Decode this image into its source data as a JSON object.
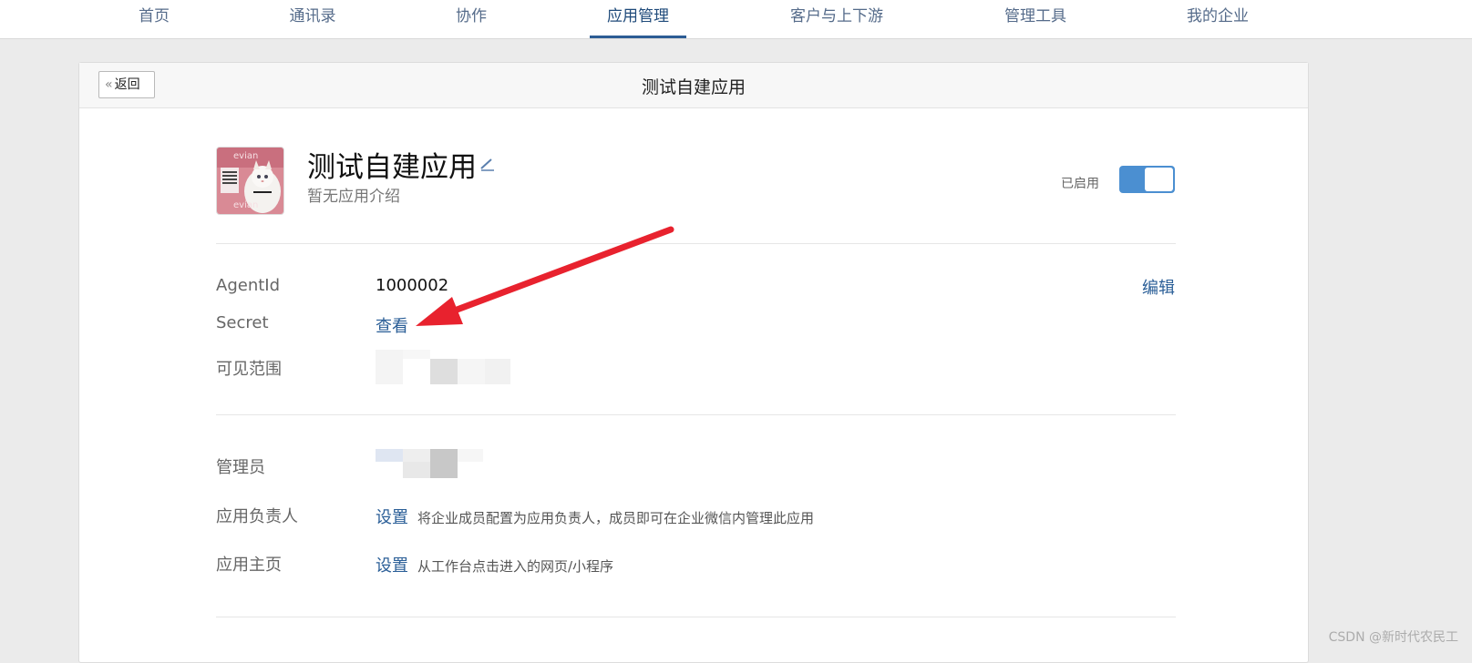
{
  "nav": {
    "items": [
      {
        "label": "首页",
        "active": false
      },
      {
        "label": "通讯录",
        "active": false
      },
      {
        "label": "协作",
        "active": false
      },
      {
        "label": "应用管理",
        "active": true
      },
      {
        "label": "客户与上下游",
        "active": false
      },
      {
        "label": "管理工具",
        "active": false
      },
      {
        "label": "我的企业",
        "active": false
      }
    ]
  },
  "header": {
    "back_label": "返回",
    "title": "测试自建应用"
  },
  "app": {
    "name": "测试自建应用",
    "description": "暂无应用介绍",
    "status_label": "已启用",
    "enabled": true,
    "logo_text_top": "evian",
    "logo_text_bottom": "evian"
  },
  "details": {
    "agentid_label": "AgentId",
    "agentid_value": "1000002",
    "edit_label": "编辑",
    "secret_label": "Secret",
    "secret_action": "查看",
    "visible_range_label": "可见范围"
  },
  "admin": {
    "admin_label": "管理员",
    "owner_label": "应用负责人",
    "owner_action": "设置",
    "owner_hint": "将企业成员配置为应用负责人，成员即可在企业微信内管理此应用",
    "home_label": "应用主页",
    "home_action": "设置",
    "home_hint": "从工作台点击进入的网页/小程序"
  },
  "watermark": "CSDN @新时代农民工",
  "colors": {
    "accent": "#2a5e97",
    "toggle": "#4b8fd1",
    "arrow": "#e8222e"
  }
}
